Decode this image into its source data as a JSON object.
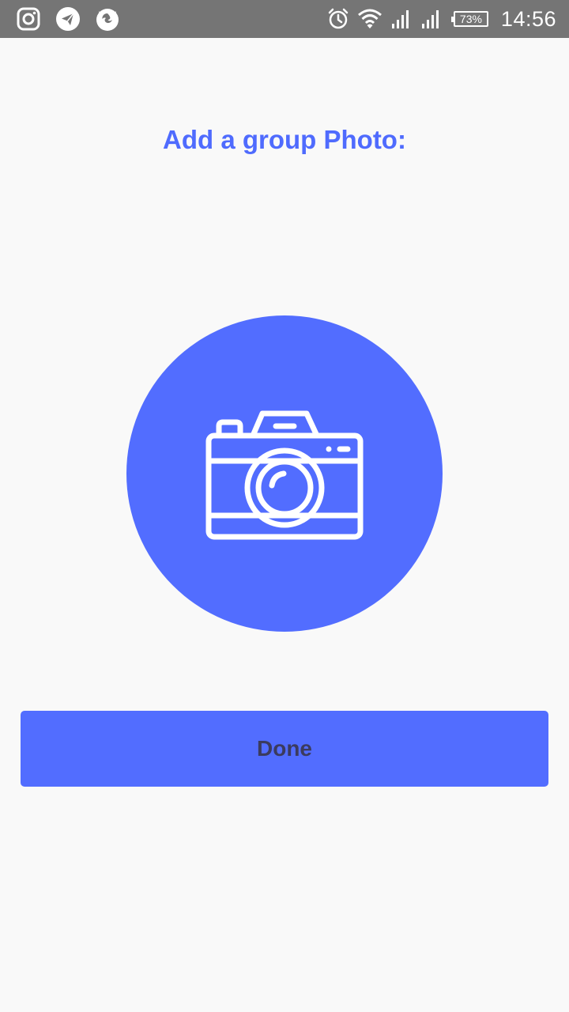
{
  "status_bar": {
    "left_icons": [
      "instagram-icon",
      "telegram-icon",
      "firefox-icon"
    ],
    "right_icons": [
      "alarm-icon",
      "wifi-icon",
      "signal-icon",
      "signal-icon"
    ],
    "battery_percent": "73%",
    "time": "14:56"
  },
  "main": {
    "title": "Add a group Photo:",
    "photo_picker_icon": "camera-icon",
    "done_label": "Done"
  },
  "colors": {
    "accent": "#526dff",
    "title": "#4f6bfe",
    "button_text": "#3b3b5e",
    "background": "#f9f9f9",
    "status_bar": "#757575"
  }
}
